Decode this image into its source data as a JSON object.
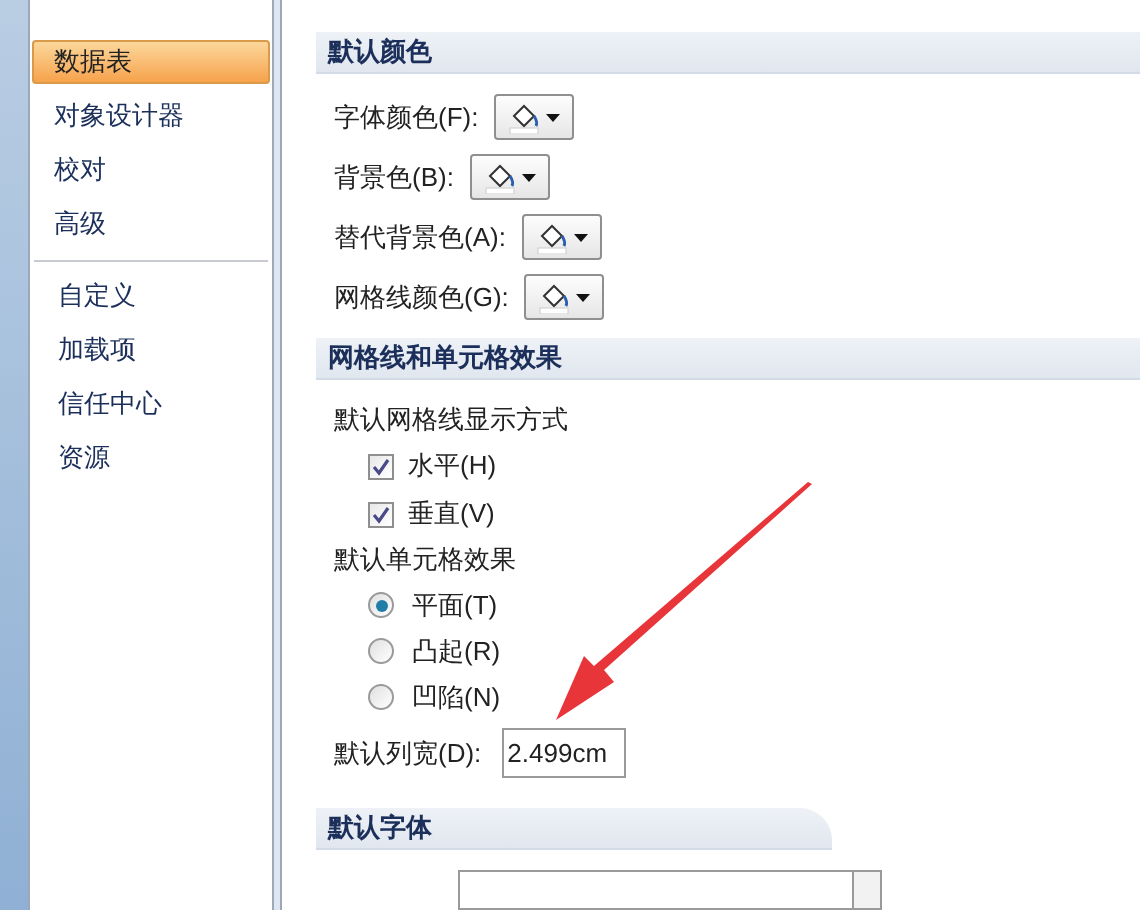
{
  "sidebar": {
    "groups": [
      [
        {
          "label": "数据表",
          "selected": true
        },
        {
          "label": "对象设计器",
          "selected": false
        },
        {
          "label": "校对",
          "selected": false
        },
        {
          "label": "高级",
          "selected": false
        }
      ],
      [
        {
          "label": "自定义",
          "selected": false
        },
        {
          "label": "加载项",
          "selected": false
        },
        {
          "label": "信任中心",
          "selected": false
        },
        {
          "label": "资源",
          "selected": false
        }
      ]
    ]
  },
  "colors_section": {
    "title": "默认颜色",
    "pickers": [
      {
        "label": "字体颜色(F):"
      },
      {
        "label": "背景色(B):"
      },
      {
        "label": "替代背景色(A):"
      },
      {
        "label": "网格线颜色(G):"
      }
    ]
  },
  "grid_section": {
    "title": "网格线和单元格效果",
    "gridlines": {
      "label": "默认网格线显示方式",
      "options": [
        {
          "label": "水平(H)",
          "checked": true
        },
        {
          "label": "垂直(V)",
          "checked": true
        }
      ]
    },
    "cell_effect": {
      "label": "默认单元格效果",
      "options": [
        {
          "label": "平面(T)",
          "selected": true
        },
        {
          "label": "凸起(R)",
          "selected": false
        },
        {
          "label": "凹陷(N)",
          "selected": false
        }
      ]
    },
    "column_width": {
      "label": "默认列宽(D):",
      "value": "2.499cm"
    }
  },
  "font_section": {
    "title": "默认字体"
  }
}
